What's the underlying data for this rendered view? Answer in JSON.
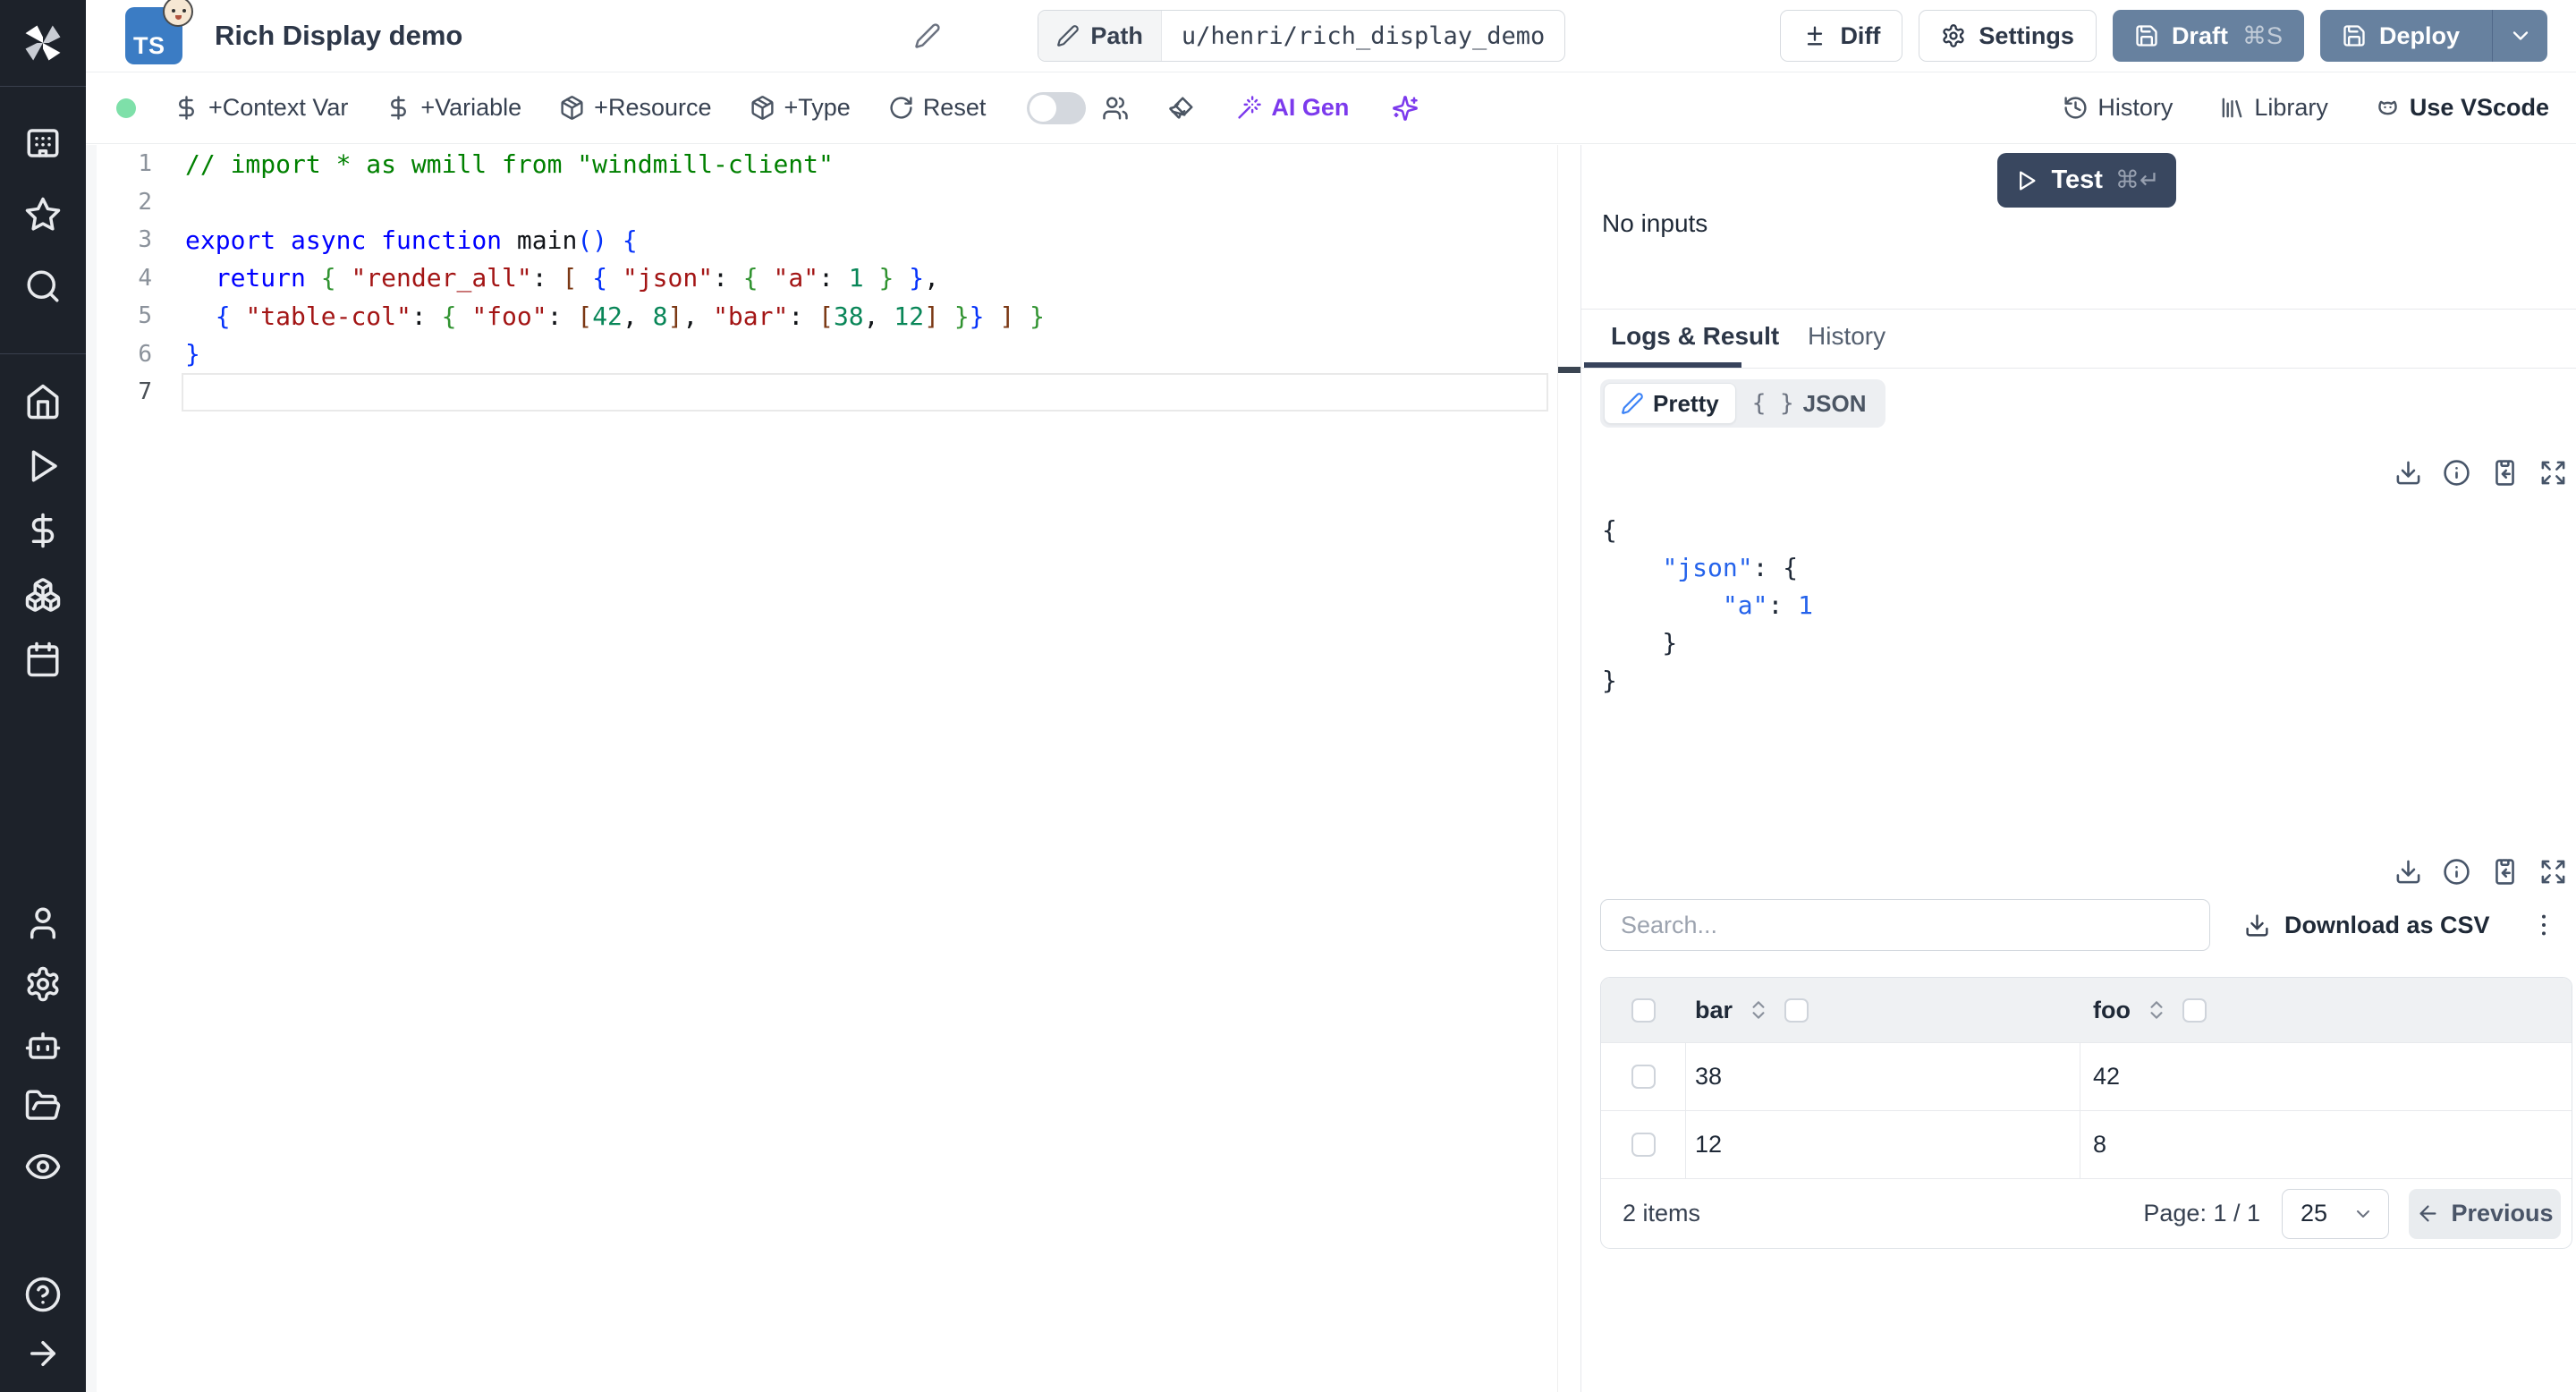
{
  "window": {
    "title": "Rich Display demo",
    "lang_badge": "TS",
    "path_label": "Path",
    "path_value": "u/henri/rich_display_demo"
  },
  "header": {
    "diff": "Diff",
    "settings": "Settings",
    "draft": "Draft",
    "draft_shortcut": "⌘S",
    "deploy": "Deploy"
  },
  "toolbar": {
    "context_var": "+Context Var",
    "variable": "+Variable",
    "resource": "+Resource",
    "type": "+Type",
    "reset": "Reset",
    "ai_gen": "AI Gen",
    "history": "History",
    "library": "Library",
    "vscode": "Use VScode"
  },
  "sidebar": {
    "icons": [
      "windmill-logo",
      "apps",
      "favorites",
      "search",
      "home",
      "runs",
      "variables",
      "resources",
      "schedules",
      "user",
      "settings",
      "workers",
      "folders",
      "audit-logs",
      "help",
      "collapse"
    ]
  },
  "editor": {
    "lines": [
      {
        "n": "1",
        "tokens": [
          {
            "t": "// import * as wmill from \"windmill-client\"",
            "c": "cmt"
          }
        ]
      },
      {
        "n": "2",
        "tokens": []
      },
      {
        "n": "3",
        "tokens": [
          {
            "t": "export",
            "c": "kw"
          },
          {
            "t": " ",
            "c": "pl"
          },
          {
            "t": "async",
            "c": "kw"
          },
          {
            "t": " ",
            "c": "pl"
          },
          {
            "t": "function",
            "c": "kw"
          },
          {
            "t": " main",
            "c": "pl"
          },
          {
            "t": "() {",
            "c": "b1"
          }
        ]
      },
      {
        "n": "4",
        "tokens": [
          {
            "t": "  ",
            "c": "pl"
          },
          {
            "t": "return",
            "c": "kw"
          },
          {
            "t": " ",
            "c": "pl"
          },
          {
            "t": "{",
            "c": "b2"
          },
          {
            "t": " ",
            "c": "pl"
          },
          {
            "t": "\"render_all\"",
            "c": "str"
          },
          {
            "t": ": ",
            "c": "pl"
          },
          {
            "t": "[",
            "c": "b3"
          },
          {
            "t": " ",
            "c": "pl"
          },
          {
            "t": "{",
            "c": "b1"
          },
          {
            "t": " ",
            "c": "pl"
          },
          {
            "t": "\"json\"",
            "c": "str"
          },
          {
            "t": ": ",
            "c": "pl"
          },
          {
            "t": "{",
            "c": "b2"
          },
          {
            "t": " ",
            "c": "pl"
          },
          {
            "t": "\"a\"",
            "c": "str"
          },
          {
            "t": ": ",
            "c": "pl"
          },
          {
            "t": "1",
            "c": "num"
          },
          {
            "t": " ",
            "c": "pl"
          },
          {
            "t": "}",
            "c": "b2"
          },
          {
            "t": " ",
            "c": "pl"
          },
          {
            "t": "}",
            "c": "b1"
          },
          {
            "t": ",",
            "c": "pl"
          }
        ]
      },
      {
        "n": "5",
        "tokens": [
          {
            "t": "  ",
            "c": "pl"
          },
          {
            "t": "{",
            "c": "b1"
          },
          {
            "t": " ",
            "c": "pl"
          },
          {
            "t": "\"table-col\"",
            "c": "str"
          },
          {
            "t": ": ",
            "c": "pl"
          },
          {
            "t": "{",
            "c": "b2"
          },
          {
            "t": " ",
            "c": "pl"
          },
          {
            "t": "\"foo\"",
            "c": "str"
          },
          {
            "t": ": ",
            "c": "pl"
          },
          {
            "t": "[",
            "c": "b3"
          },
          {
            "t": "42",
            "c": "num"
          },
          {
            "t": ", ",
            "c": "pl"
          },
          {
            "t": "8",
            "c": "num"
          },
          {
            "t": "]",
            "c": "b3"
          },
          {
            "t": ", ",
            "c": "pl"
          },
          {
            "t": "\"bar\"",
            "c": "str"
          },
          {
            "t": ": ",
            "c": "pl"
          },
          {
            "t": "[",
            "c": "b3"
          },
          {
            "t": "38",
            "c": "num"
          },
          {
            "t": ", ",
            "c": "pl"
          },
          {
            "t": "12",
            "c": "num"
          },
          {
            "t": "]",
            "c": "b3"
          },
          {
            "t": " ",
            "c": "pl"
          },
          {
            "t": "}",
            "c": "b2"
          },
          {
            "t": "}",
            "c": "b1"
          },
          {
            "t": " ",
            "c": "pl"
          },
          {
            "t": "]",
            "c": "b3"
          },
          {
            "t": " ",
            "c": "pl"
          },
          {
            "t": "}",
            "c": "b2"
          }
        ]
      },
      {
        "n": "6",
        "tokens": [
          {
            "t": "}",
            "c": "b1"
          }
        ]
      },
      {
        "n": "7",
        "tokens": []
      }
    ]
  },
  "run": {
    "test": "Test",
    "test_shortcut": "⌘↵",
    "no_inputs": "No inputs",
    "tab_logs": "Logs & Result",
    "tab_history": "History",
    "view_pretty": "Pretty",
    "view_json": "JSON",
    "braces_glyph": "{ }"
  },
  "result": {
    "lines": [
      [
        {
          "t": "{",
          "c": "p"
        }
      ],
      [
        {
          "t": "    ",
          "c": "p"
        },
        {
          "t": "\"json\"",
          "c": "k"
        },
        {
          "t": ": {",
          "c": "p"
        }
      ],
      [
        {
          "t": "        ",
          "c": "p"
        },
        {
          "t": "\"a\"",
          "c": "k"
        },
        {
          "t": ": ",
          "c": "p"
        },
        {
          "t": "1",
          "c": "v"
        }
      ],
      [
        {
          "t": "    }",
          "c": "p"
        }
      ],
      [
        {
          "t": "}",
          "c": "p"
        }
      ]
    ]
  },
  "table": {
    "search_placeholder": "Search...",
    "download_csv": "Download as CSV",
    "columns": [
      "bar",
      "foo"
    ],
    "rows": [
      [
        "38",
        "42"
      ],
      [
        "12",
        "8"
      ]
    ],
    "items_count": "2 items",
    "page": "Page: 1 / 1",
    "page_size": "25",
    "previous": "Previous"
  },
  "colors": {
    "primary_button": "#67819f",
    "test_button": "#39475f",
    "sidebar_bg": "#1d222a",
    "status_dot_green": "#7ee0a9",
    "ai_purple": "#7c3aed",
    "ts_badge_blue": "#3b7cc4"
  }
}
